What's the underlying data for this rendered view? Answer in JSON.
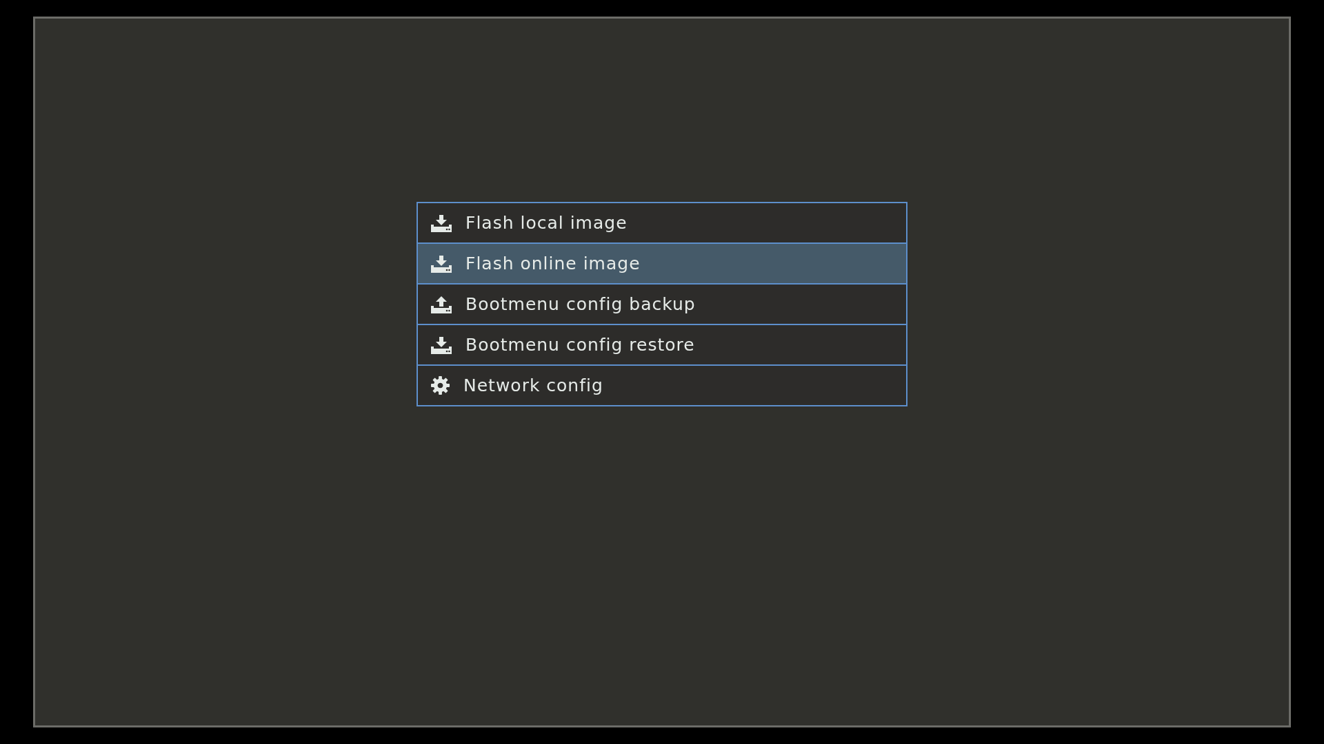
{
  "menu": {
    "items": [
      {
        "kind": "download",
        "label": "Flash local image",
        "selected": false
      },
      {
        "kind": "download",
        "label": "Flash online image",
        "selected": true
      },
      {
        "kind": "upload",
        "label": "Bootmenu config backup",
        "selected": false
      },
      {
        "kind": "download",
        "label": "Bootmenu config restore",
        "selected": false
      },
      {
        "kind": "settings",
        "label": "Network config",
        "selected": false
      }
    ]
  }
}
